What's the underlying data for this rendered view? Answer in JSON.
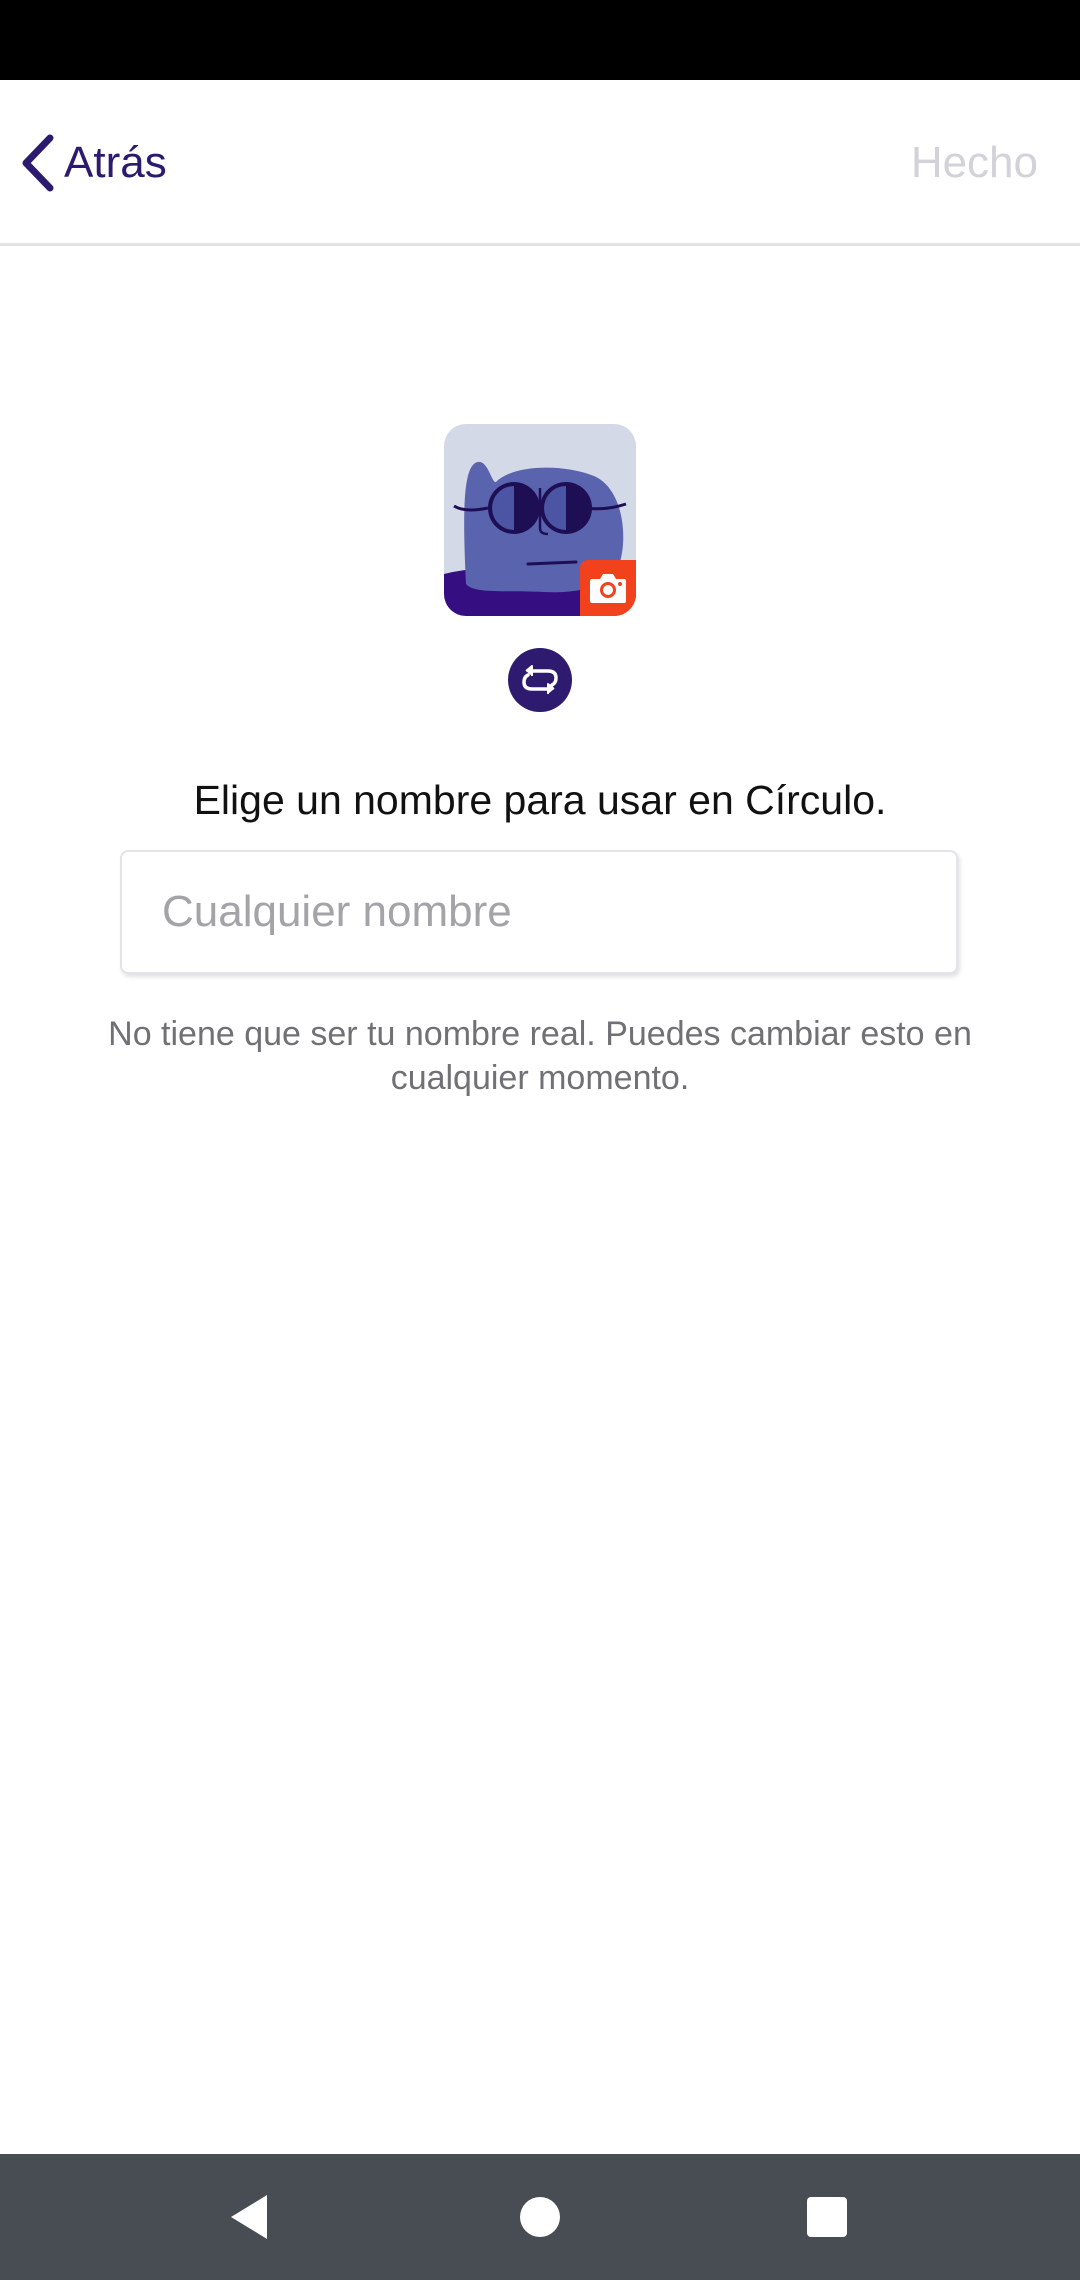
{
  "header": {
    "back_label": "Atrás",
    "done_label": "Hecho"
  },
  "profile": {
    "avatar_icon": "avatar-illustration",
    "camera_icon": "camera-icon",
    "shuffle_icon": "shuffle-icon"
  },
  "form": {
    "prompt": "Elige un nombre para usar en Círculo.",
    "name_placeholder": "Cualquier nombre",
    "name_value": "",
    "hint": "No tiene que ser tu nombre real. Puedes cambiar esto en cualquier momento."
  },
  "colors": {
    "accent": "#2e1a6e",
    "camera_badge": "#f2411d",
    "done_disabled": "#d2d2d8",
    "nav_bar": "#474d52"
  },
  "system_nav": {
    "back_icon": "nav-back-icon",
    "home_icon": "nav-home-icon",
    "recents_icon": "nav-recents-icon"
  }
}
